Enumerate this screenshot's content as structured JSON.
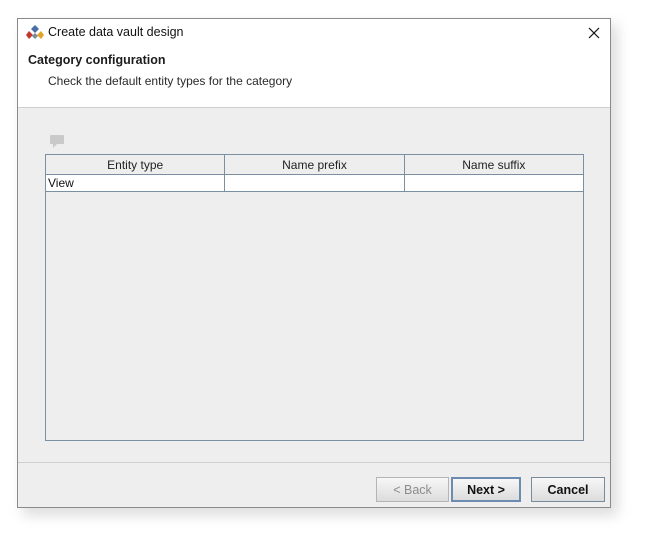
{
  "window": {
    "title": "Create data vault design",
    "close_symbol": "✕"
  },
  "header": {
    "title": "Category configuration",
    "subtitle": "Check the default entity types for the category"
  },
  "table": {
    "columns": [
      "Entity type",
      "Name prefix",
      "Name suffix"
    ],
    "rows": [
      [
        "View",
        "",
        ""
      ]
    ]
  },
  "buttons": {
    "back_label": "< Back",
    "next_label": "Next >",
    "cancel_label": "Cancel"
  },
  "icons": {
    "app": "data-vault-app-icon",
    "toolbar": "comment-icon",
    "close": "close-icon"
  }
}
